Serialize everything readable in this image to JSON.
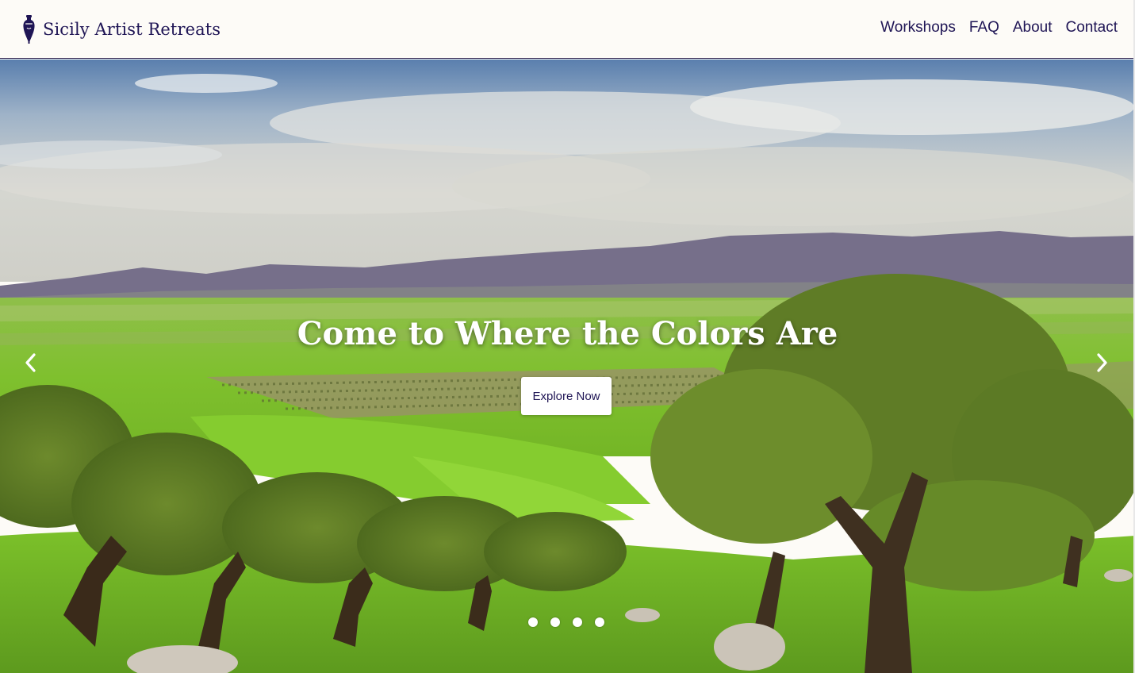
{
  "header": {
    "brand_name": "Sicily Artist Retreats",
    "brand_icon": "amphora-icon",
    "nav": [
      {
        "label": "Workshops"
      },
      {
        "label": "FAQ"
      },
      {
        "label": "About"
      },
      {
        "label": "Contact"
      }
    ]
  },
  "hero": {
    "title": "Come to Where the Colors Are",
    "cta_label": "Explore Now",
    "prev_icon": "chevron-left-icon",
    "next_icon": "chevron-right-icon",
    "slide_count": 4,
    "image": "olive-grove-landscape"
  },
  "colors": {
    "brand": "#1f1555",
    "header_bg": "#fdfbf7",
    "cta_bg": "#ffffff",
    "hero_text": "#ffffff"
  }
}
